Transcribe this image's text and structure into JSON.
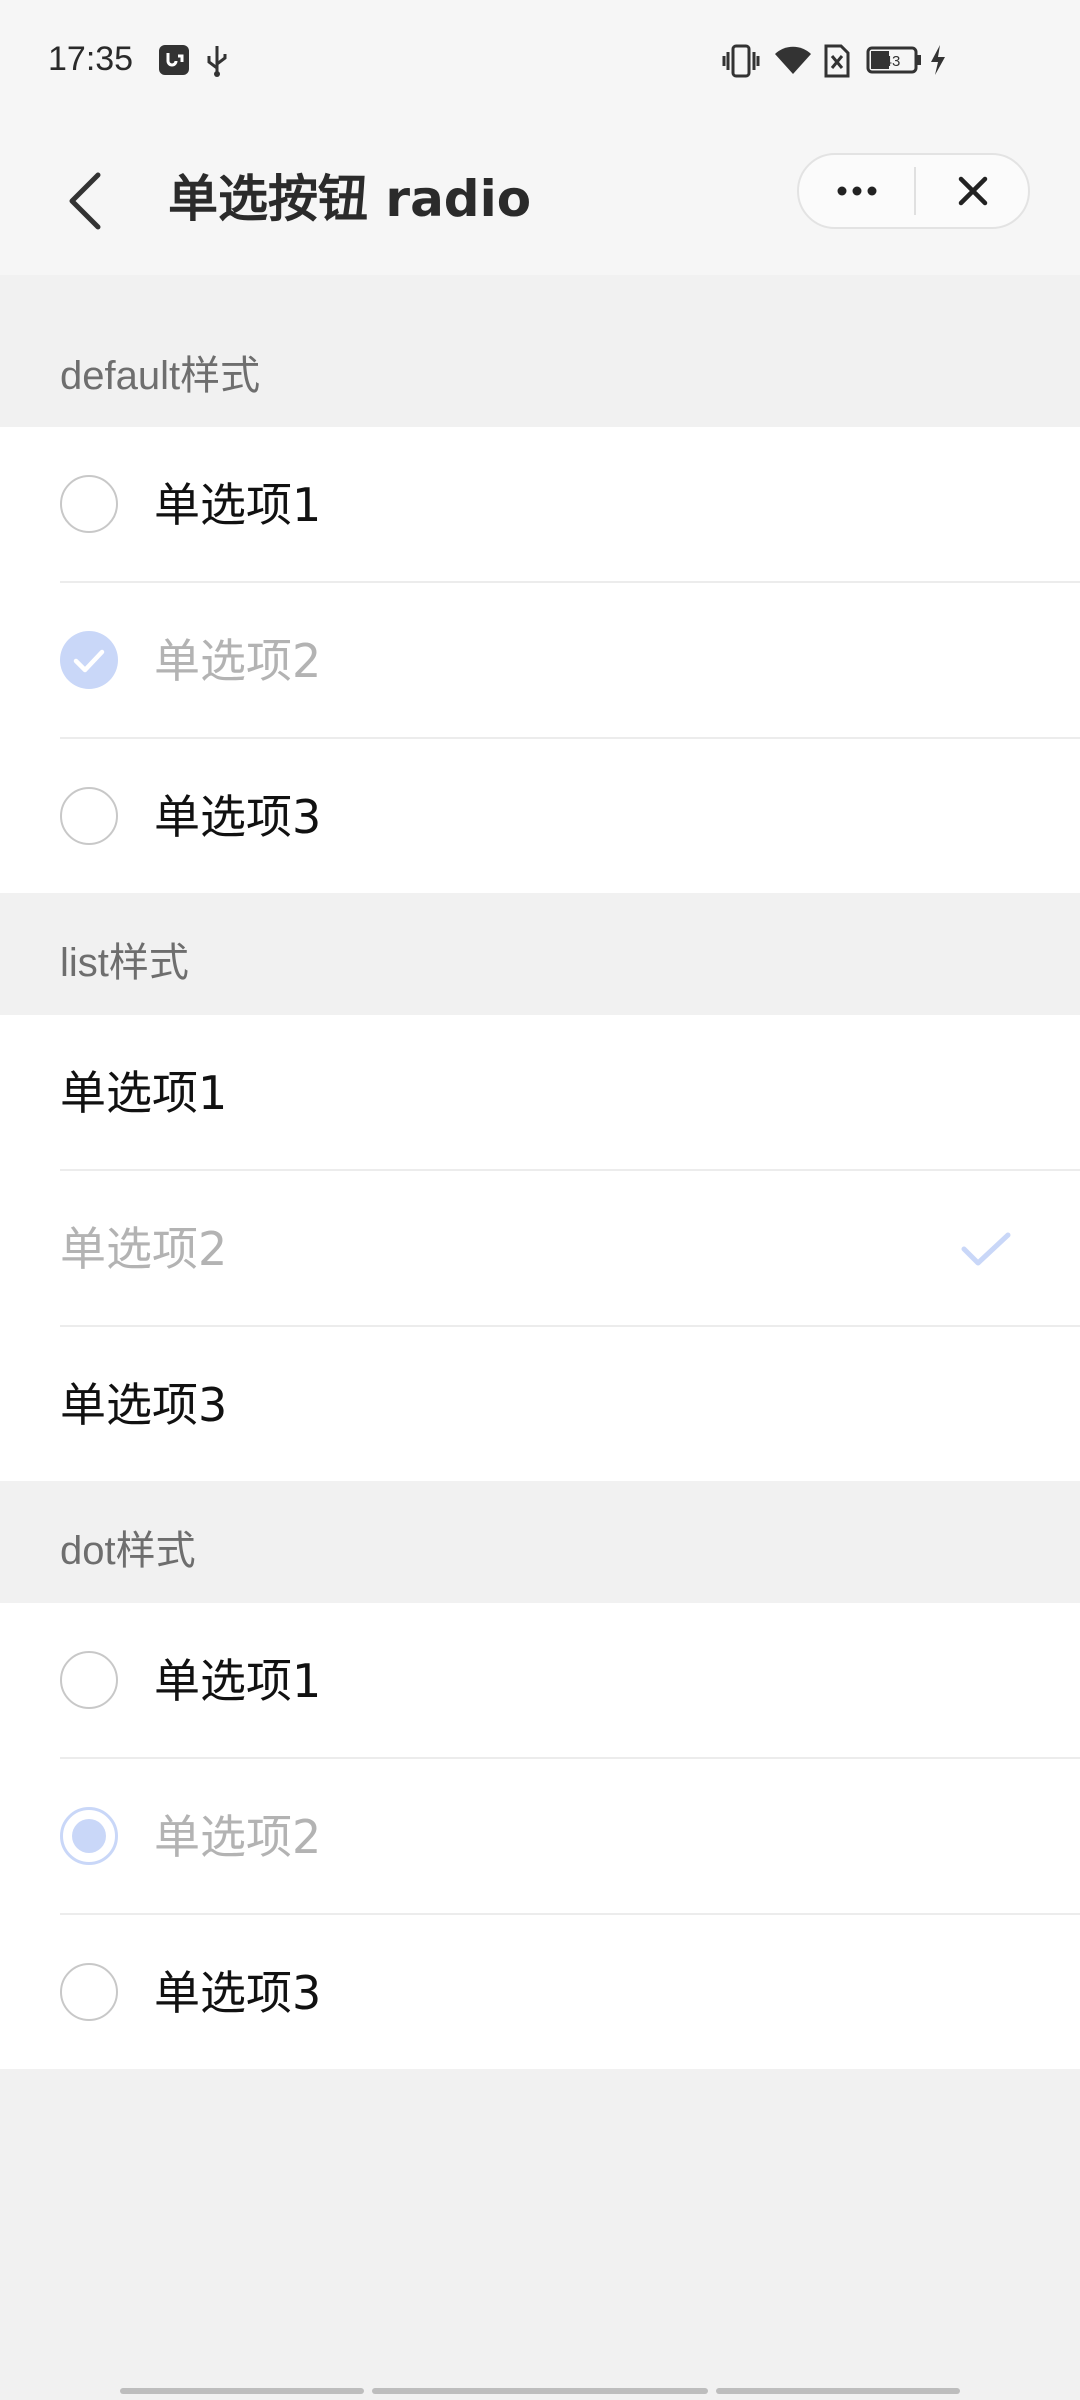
{
  "status_bar": {
    "time": "17:35",
    "battery": "43",
    "icons": [
      "usb-debug-icon",
      "usb-icon",
      "vibrate-icon",
      "wifi-icon",
      "sim-off-icon",
      "battery-icon",
      "charging-icon"
    ]
  },
  "nav": {
    "title": "单选按钮 radio",
    "back_icon": "chevron-left-icon",
    "more_icon": "more-dots-icon",
    "close_icon": "close-icon"
  },
  "colors": {
    "accent_disabled": "#c9d7f8",
    "background": "#f1f1f1",
    "card": "#ffffff"
  },
  "sections": {
    "default": {
      "title": "default样式",
      "items": [
        {
          "label": "单选项1",
          "checked": false,
          "disabled": false
        },
        {
          "label": "单选项2",
          "checked": true,
          "disabled": true
        },
        {
          "label": "单选项3",
          "checked": false,
          "disabled": false
        }
      ]
    },
    "list": {
      "title": "list样式",
      "items": [
        {
          "label": "单选项1",
          "checked": false,
          "disabled": false
        },
        {
          "label": "单选项2",
          "checked": true,
          "disabled": true
        },
        {
          "label": "单选项3",
          "checked": false,
          "disabled": false
        }
      ]
    },
    "dot": {
      "title": "dot样式",
      "items": [
        {
          "label": "单选项1",
          "checked": false,
          "disabled": false
        },
        {
          "label": "单选项2",
          "checked": true,
          "disabled": true
        },
        {
          "label": "单选项3",
          "checked": false,
          "disabled": false
        }
      ]
    }
  }
}
